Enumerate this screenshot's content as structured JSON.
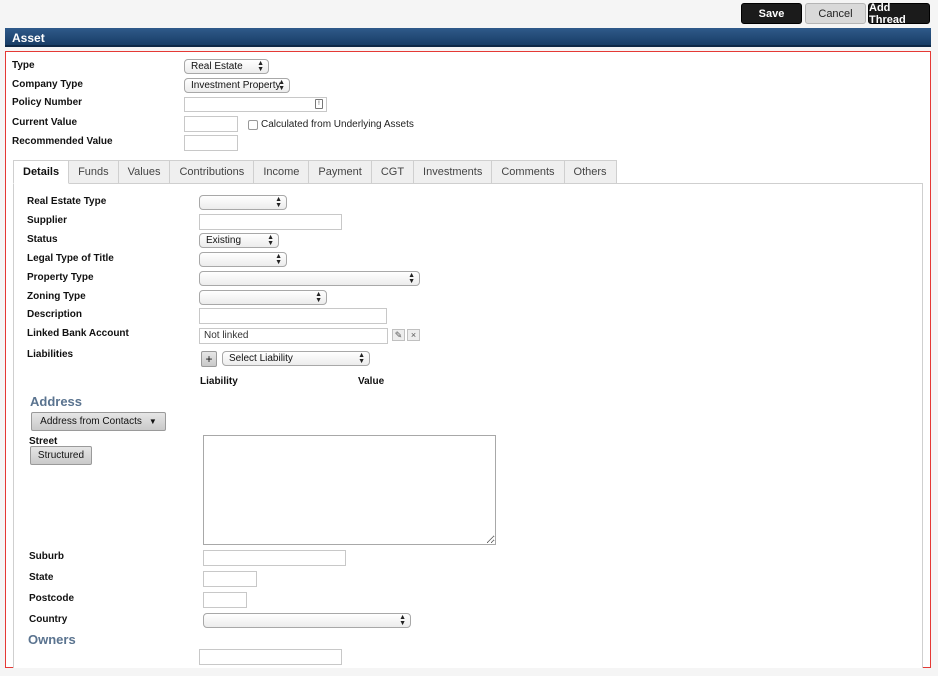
{
  "toolbar": {
    "save": "Save",
    "cancel": "Cancel",
    "add_thread": "Add Thread"
  },
  "header": {
    "title": "Asset"
  },
  "top_fields": {
    "type_label": "Type",
    "type_value": "Real Estate",
    "company_type_label": "Company Type",
    "company_type_value": "Investment Property",
    "policy_number_label": "Policy Number",
    "policy_number_value": "",
    "current_value_label": "Current Value",
    "current_value_value": "",
    "calc_checkbox_label": "Calculated from Underlying Assets",
    "recommended_value_label": "Recommended Value",
    "recommended_value_value": ""
  },
  "tabs": [
    "Details",
    "Funds",
    "Values",
    "Contributions",
    "Income",
    "Payment",
    "CGT",
    "Investments",
    "Comments",
    "Others"
  ],
  "details": {
    "real_estate_type_label": "Real Estate Type",
    "real_estate_type_value": "",
    "supplier_label": "Supplier",
    "supplier_value": "",
    "status_label": "Status",
    "status_value": "Existing",
    "legal_type_label": "Legal Type of Title",
    "legal_type_value": "",
    "property_type_label": "Property Type",
    "property_type_value": "",
    "zoning_type_label": "Zoning Type",
    "zoning_type_value": "",
    "description_label": "Description",
    "description_value": "",
    "linked_bank_label": "Linked Bank Account",
    "linked_bank_value": "Not linked",
    "liabilities_label": "Liabilities",
    "liability_select": "Select Liability",
    "add_symbol": "+",
    "col_liability": "Liability",
    "col_value": "Value"
  },
  "address": {
    "title": "Address",
    "from_contacts": "Address from Contacts",
    "street_label": "Street",
    "structured_button": "Structured",
    "street_value": "",
    "suburb_label": "Suburb",
    "suburb_value": "",
    "state_label": "State",
    "state_value": "",
    "postcode_label": "Postcode",
    "postcode_value": "",
    "country_label": "Country",
    "country_value": ""
  },
  "owners": {
    "title": "Owners",
    "owner_value": ""
  },
  "icons": {
    "calendar": "calendar-icon",
    "edit": "pencil-icon",
    "remove": "remove-icon",
    "dropdown": "caret-down-icon"
  },
  "colors": {
    "header": "#183d66",
    "frame_border": "#e53935",
    "section_title": "#5a738f"
  }
}
